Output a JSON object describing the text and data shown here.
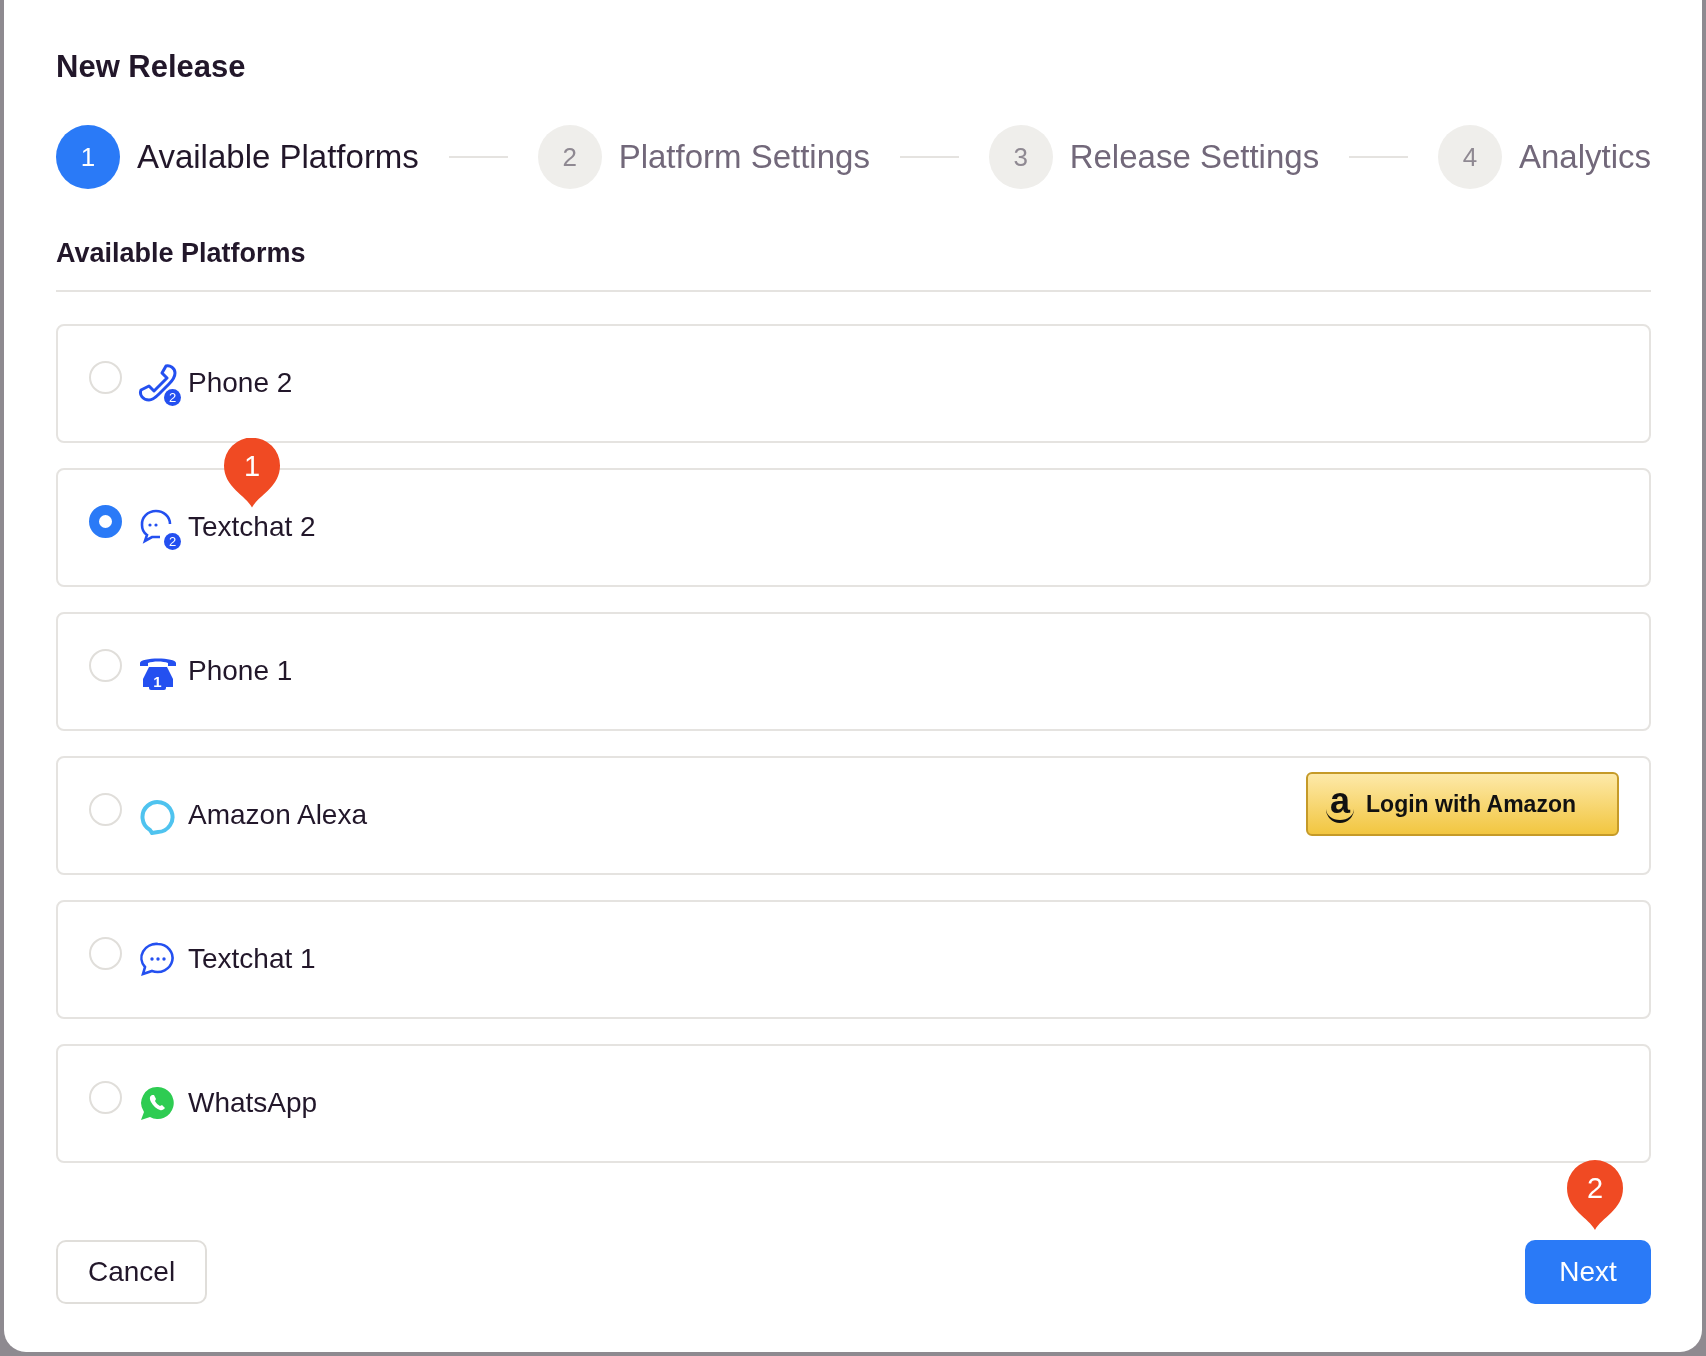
{
  "dialog": {
    "title": "New Release"
  },
  "steps": [
    {
      "number": "1",
      "label": "Available Platforms",
      "selected": true
    },
    {
      "number": "2",
      "label": "Platform Settings",
      "selected": false
    },
    {
      "number": "3",
      "label": "Release Settings",
      "selected": false
    },
    {
      "number": "4",
      "label": "Analytics",
      "selected": false
    }
  ],
  "section_title": "Available Platforms",
  "platforms": [
    {
      "label": "Phone 2",
      "selected": false,
      "icon_badge": "2"
    },
    {
      "label": "Textchat 2",
      "selected": true,
      "marker": "1",
      "icon_badge": "2"
    },
    {
      "label": "Phone 1",
      "selected": false,
      "icon_badge": "1"
    },
    {
      "label": "Amazon Alexa",
      "selected": false,
      "action_button": "Login with Amazon",
      "action_logo": "a"
    },
    {
      "label": "Textchat 1",
      "selected": false
    },
    {
      "label": "WhatsApp",
      "selected": false
    }
  ],
  "buttons": {
    "cancel": "Cancel",
    "next": "Next",
    "next_marker": "2"
  }
}
